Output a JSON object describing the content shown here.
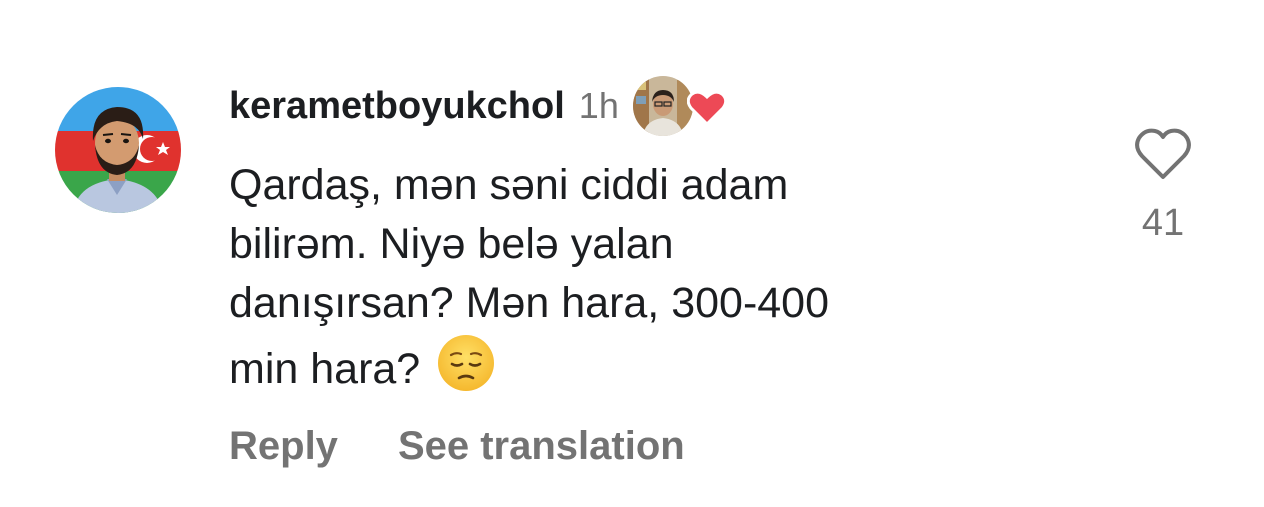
{
  "comment": {
    "username": "kerametboyukchol",
    "timestamp": "1h",
    "text_lines": [
      "Qardaş, mən səni ciddi adam",
      "bilirəm. Niyə belə yalan",
      "danışırsan? Mən hara, 300-400",
      "min hara?"
    ],
    "emoji": "pensive-face",
    "actions": {
      "reply": "Reply",
      "see_translation": "See translation"
    },
    "likes": {
      "count": "41",
      "icon": "heart-outline-icon"
    },
    "liked_by_author": {
      "icon": "heart-filled-icon",
      "color": "#ed4956"
    }
  },
  "colors": {
    "text_primary": "#1c1e21",
    "text_secondary": "#737373",
    "heart_red": "#ed4956",
    "background": "#ffffff"
  }
}
